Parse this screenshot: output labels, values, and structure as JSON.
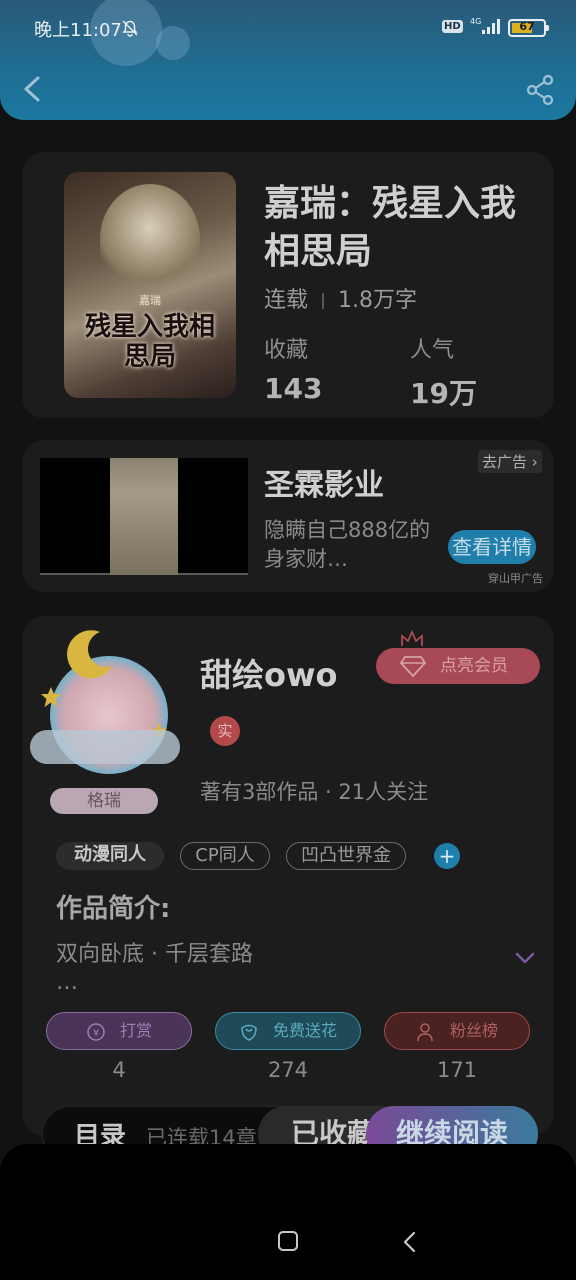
{
  "status_bar": {
    "time": "晚上11:07",
    "network_badge": "HD",
    "network_type": "4G",
    "battery": "67",
    "battery_level": 0.67
  },
  "book": {
    "cover_series": "嘉瑞",
    "cover_title": "残星入我相思局",
    "title": "嘉瑞：残星入我相思局",
    "status": "连载",
    "word_count": "1.8万字",
    "collect_label": "收藏",
    "collect_value": "143",
    "popularity_label": "人气",
    "popularity_value": "19万"
  },
  "ad": {
    "title": "圣霖影业",
    "description": "隐瞒自己888亿的身家财…",
    "remove_label": "去广告",
    "detail_button": "查看详情",
    "source": "穿山甲广告"
  },
  "author": {
    "name": "甜绘owo",
    "avatar_tag": "格瑞",
    "vip_button": "点亮会员",
    "real_badge": "实",
    "stats": "著有3部作品 · 21人关注"
  },
  "tags": [
    "动漫同人",
    "CP同人",
    "凹凸世界金"
  ],
  "intro": {
    "label": "作品简介:",
    "text": "双向卧底 · 千层套路",
    "ellipsis": "…"
  },
  "actions": [
    {
      "label": "打赏",
      "count": "4",
      "icon": "yen-icon"
    },
    {
      "label": "免费送花",
      "count": "274",
      "icon": "flower-icon"
    },
    {
      "label": "粉丝榜",
      "count": "171",
      "icon": "user-icon"
    }
  ],
  "bottom": {
    "toc_label": "目录",
    "toc_sub": "已连载14章",
    "collected_label": "已收藏",
    "read_label": "继续阅读"
  },
  "colors": {
    "header": "#1f6e93",
    "accent_blue": "#1f7faa",
    "vip_red": "#a84a55"
  }
}
